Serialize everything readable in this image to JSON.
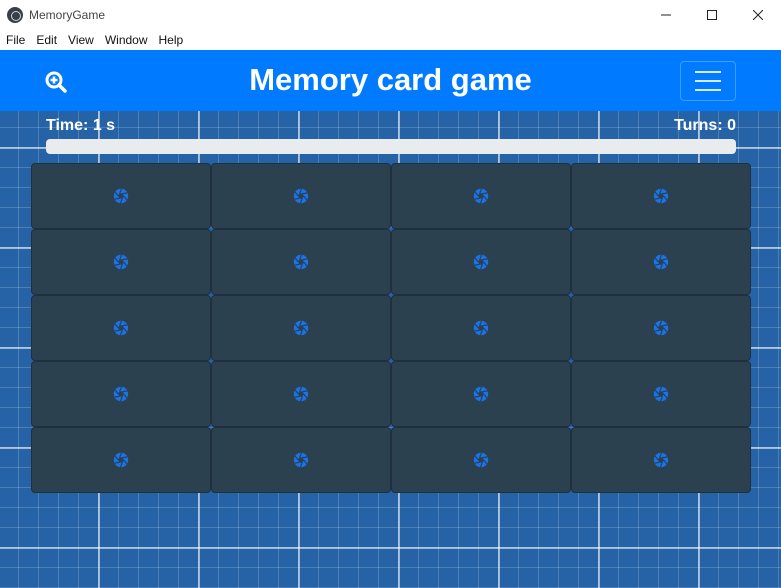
{
  "window": {
    "title": "MemoryGame",
    "controls": [
      "minimize",
      "maximize",
      "close"
    ]
  },
  "menu": {
    "items": [
      "File",
      "Edit",
      "View",
      "Window",
      "Help"
    ]
  },
  "navbar": {
    "title": "Memory card game",
    "zoom_icon": "zoom-in-icon",
    "toggle_icon": "hamburger-menu-icon"
  },
  "stats": {
    "time_label": "Time: 1 s",
    "turns_label": "Turns: 0",
    "progress_fraction": 0.0
  },
  "board": {
    "rows": 5,
    "columns": 4,
    "card_icon": "camera-aperture-icon",
    "card_face": "hidden"
  },
  "colors": {
    "navbar": "#007bff",
    "background": "#2563a6",
    "card": "#2b4150",
    "card_icon": "#1a73e8"
  }
}
